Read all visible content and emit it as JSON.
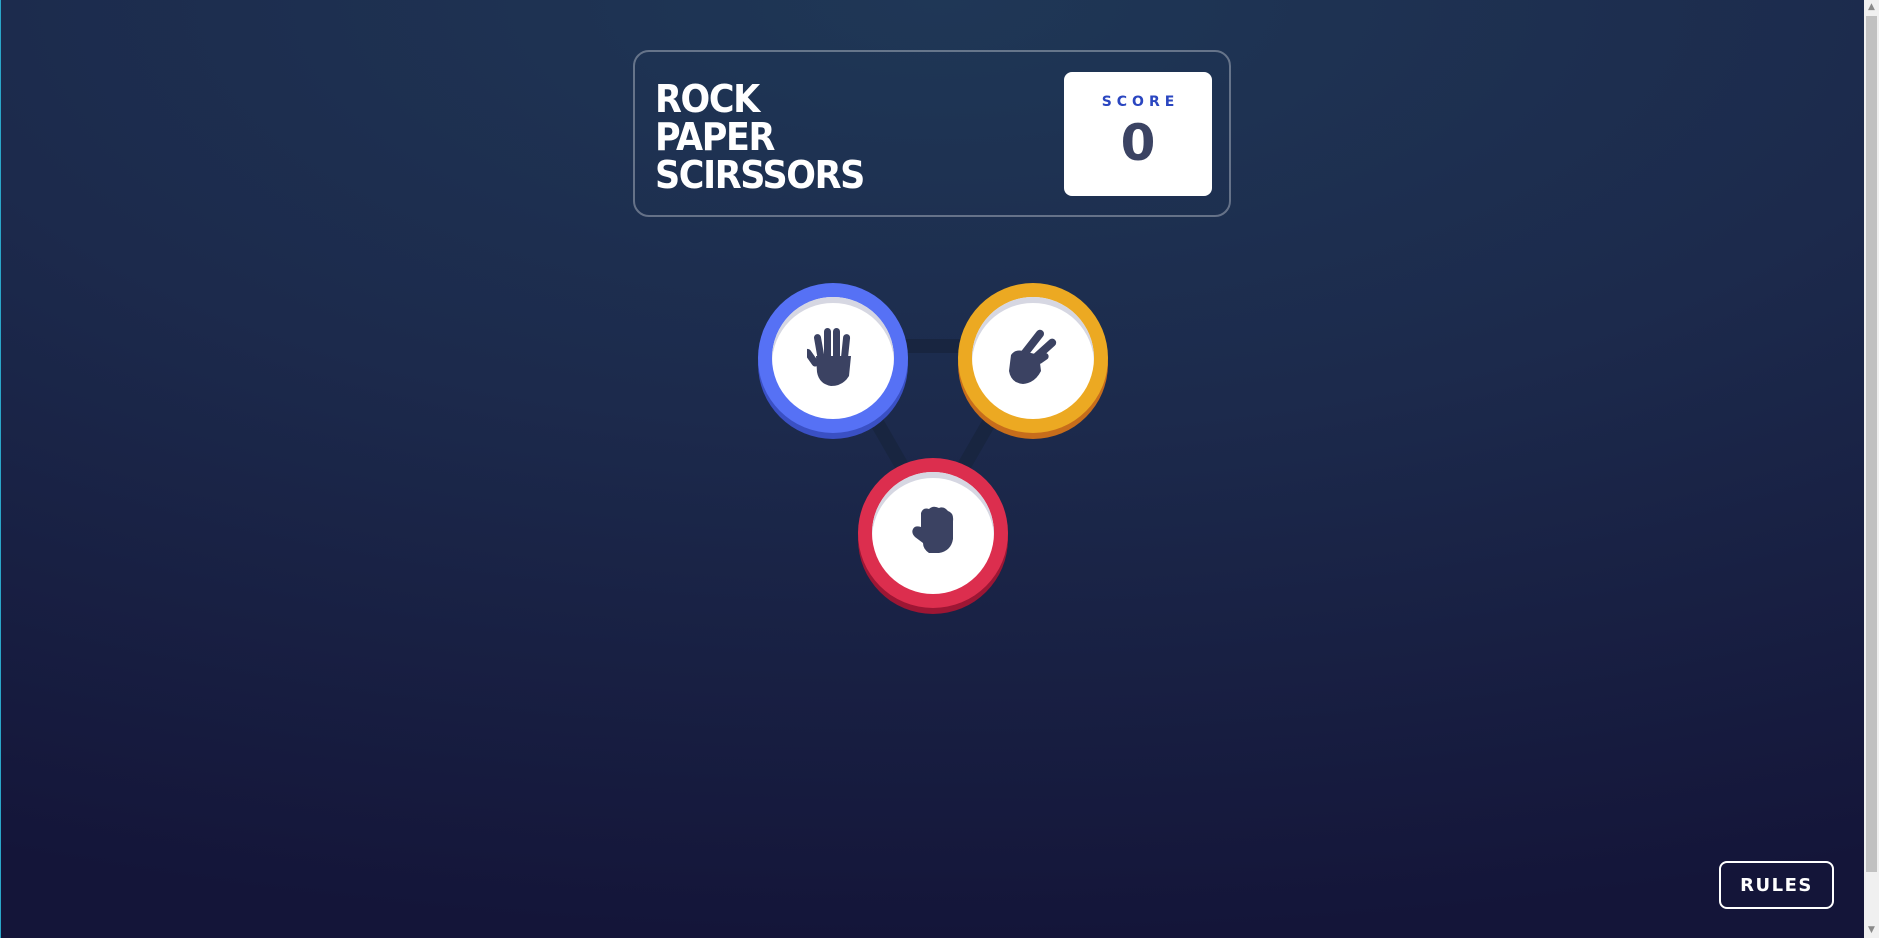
{
  "header": {
    "title_lines": [
      "ROCK",
      "PAPER",
      "SCIRSSORS"
    ],
    "score_label": "SCORE",
    "score_value": "0"
  },
  "choices": [
    {
      "id": "paper",
      "icon": "paper-hand-icon",
      "color": "#5671f5"
    },
    {
      "id": "scissors",
      "icon": "scissors-hand-icon",
      "color": "#eca922"
    },
    {
      "id": "rock",
      "icon": "rock-hand-icon",
      "color": "#dc2e4e"
    }
  ],
  "rules_button": {
    "label": "RULES"
  },
  "colors": {
    "background_top": "#1f3756",
    "background_bottom": "#141539",
    "score_label": "#2a46c0",
    "score_value": "#3b4363"
  }
}
